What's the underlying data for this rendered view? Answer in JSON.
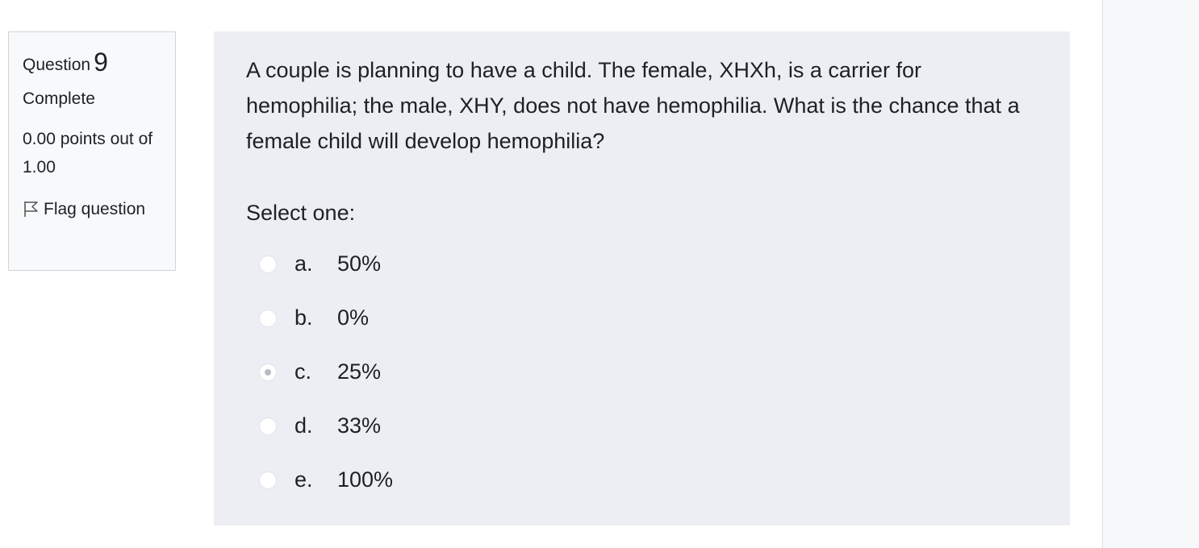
{
  "info": {
    "question_word": "Question",
    "question_number": "9",
    "state": "Complete",
    "grade": "0.00 points out of 1.00",
    "flag_label": "Flag question",
    "flag_icon": "flag-outline-icon"
  },
  "question": {
    "text": "A couple is planning to have a child.  The female, XHXh, is a carrier for hemophilia; the male, XHY, does not have hemophilia.  What is the chance that a female child will develop hemophilia?",
    "prompt": "Select one:",
    "answers": [
      {
        "letter": "a.",
        "value": "50%",
        "selected": false
      },
      {
        "letter": "b.",
        "value": "0%",
        "selected": false
      },
      {
        "letter": "c.",
        "value": "25%",
        "selected": true
      },
      {
        "letter": "d.",
        "value": "33%",
        "selected": false
      },
      {
        "letter": "e.",
        "value": "100%",
        "selected": false
      }
    ]
  },
  "colors": {
    "question_bg": "#eceef3",
    "info_bg": "#f8f9fa",
    "text": "#1d2125"
  }
}
